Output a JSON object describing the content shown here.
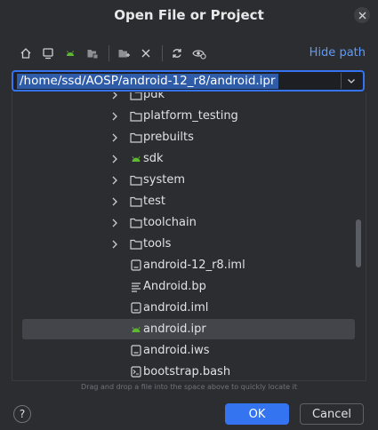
{
  "dialog": {
    "title": "Open File or Project"
  },
  "toolbar": {
    "hide_path_label": "Hide path",
    "icons": [
      "home-icon",
      "desktop-icon",
      "android-project-icon",
      "module-folder-icon",
      "new-folder-icon",
      "delete-icon",
      "refresh-icon",
      "show-hidden-icon"
    ]
  },
  "path": {
    "value": "/home/ssd/AOSP/android-12_r8/android.ipr"
  },
  "tree": {
    "items": [
      {
        "label": "pdk",
        "type": "folder",
        "expandable": true
      },
      {
        "label": "platform_testing",
        "type": "folder",
        "expandable": true
      },
      {
        "label": "prebuilts",
        "type": "folder",
        "expandable": true
      },
      {
        "label": "sdk",
        "type": "android",
        "expandable": true
      },
      {
        "label": "system",
        "type": "folder",
        "expandable": true
      },
      {
        "label": "test",
        "type": "folder",
        "expandable": true
      },
      {
        "label": "toolchain",
        "type": "folder",
        "expandable": true
      },
      {
        "label": "tools",
        "type": "folder",
        "expandable": true
      },
      {
        "label": "android-12_r8.iml",
        "type": "module-file",
        "expandable": false
      },
      {
        "label": "Android.bp",
        "type": "text-file",
        "expandable": false
      },
      {
        "label": "android.iml",
        "type": "module-file",
        "expandable": false
      },
      {
        "label": "android.ipr",
        "type": "android",
        "expandable": false,
        "selected": true
      },
      {
        "label": "android.iws",
        "type": "module-file",
        "expandable": false
      },
      {
        "label": "bootstrap.bash",
        "type": "shell-file",
        "expandable": false
      }
    ]
  },
  "hint": "Drag and drop a file into the space above to quickly locate it",
  "buttons": {
    "help": "?",
    "ok": "OK",
    "cancel": "Cancel"
  },
  "colors": {
    "background": "#2b2d30",
    "accent": "#3574f0",
    "link": "#5e9bff",
    "android_green": "#5fb832",
    "selection": "#43454a"
  }
}
